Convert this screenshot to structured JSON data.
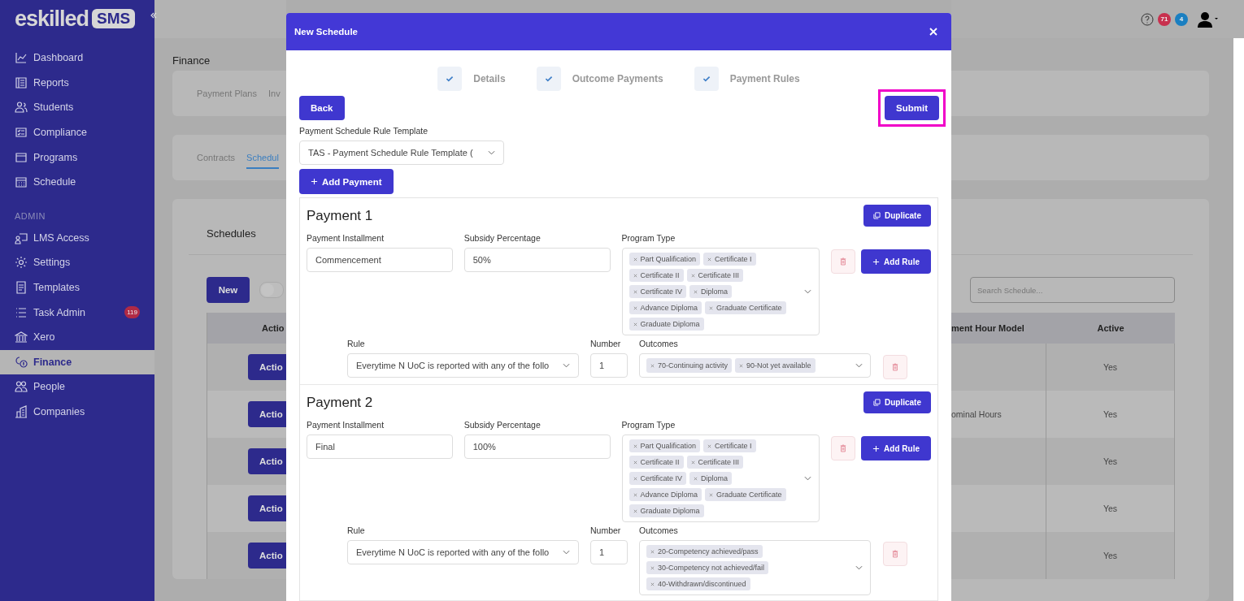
{
  "sidebar": {
    "logo": "eskilled",
    "logo_badge": "SMS",
    "groups": [
      {
        "items": [
          {
            "label": "Dashboard",
            "selected": false
          },
          {
            "label": "Reports",
            "selected": false
          },
          {
            "label": "Students",
            "selected": false
          },
          {
            "label": "Compliance",
            "selected": false
          },
          {
            "label": "Programs",
            "selected": false
          },
          {
            "label": "Schedule",
            "selected": false
          }
        ]
      },
      {
        "heading": "ADMIN",
        "items": [
          {
            "label": "LMS Access",
            "selected": false
          },
          {
            "label": "Settings",
            "selected": false
          },
          {
            "label": "Templates",
            "selected": false
          },
          {
            "label": "Task Admin",
            "selected": false,
            "badge": "119"
          },
          {
            "label": "Xero",
            "selected": false
          },
          {
            "label": "Finance",
            "selected": true
          },
          {
            "label": "People",
            "selected": false
          },
          {
            "label": "Companies",
            "selected": false
          }
        ]
      }
    ]
  },
  "topbar": {
    "badges": [
      {
        "count": "71",
        "color": "#c8304e"
      },
      {
        "count": "4",
        "color": "#1a7fc1"
      }
    ]
  },
  "page": {
    "title": "Finance",
    "tabs_top": [
      {
        "label": "Payment Plans",
        "selected": false
      },
      {
        "label": "Inv",
        "selected": false
      }
    ],
    "tabs_sub": [
      {
        "label": "Contracts",
        "selected": false
      },
      {
        "label": "Schedul",
        "selected": true
      }
    ],
    "schedules": {
      "title": "Schedules",
      "new_button": "New",
      "toggle": {
        "on": false
      },
      "search": {
        "placeholder": "Search Schedule..."
      },
      "columns": [
        "Actio",
        "ment Hour Model",
        "Active"
      ],
      "rows": [
        {
          "action": "Actio",
          "active": "Yes"
        },
        {
          "action": "Actio",
          "hour_model": "ominal Hours",
          "active": "Yes"
        },
        {
          "action": "Actio",
          "active": "Yes"
        },
        {
          "action": "Actio",
          "active": "Yes"
        },
        {
          "action": "Actio",
          "active": "Yes"
        }
      ]
    }
  },
  "modal": {
    "title": "New Schedule",
    "steps": [
      {
        "label": "Details",
        "done": true
      },
      {
        "label": "Outcome Payments",
        "done": true
      },
      {
        "label": "Payment Rules",
        "done": true
      }
    ],
    "back": "Back",
    "submit": {
      "label": "Submit",
      "highlighted": true
    },
    "template_label": "Payment Schedule Rule Template",
    "template_value": "TAS - Payment Schedule Rule Template (",
    "add_payment": "Add Payment",
    "payments": [
      {
        "title": "Payment 1",
        "duplicate": "Duplicate",
        "installment_label": "Payment Installment",
        "installment": "Commencement",
        "subsidy_label": "Subsidy Percentage",
        "subsidy": "50%",
        "program_label": "Program Type",
        "program_types": [
          "Part Qualification",
          "Certificate I",
          "Certificate II",
          "Certificate III",
          "Certificate IV",
          "Diploma",
          "Advance Diploma",
          "Graduate Certificate",
          "Graduate Diploma"
        ],
        "add_rule": "Add Rule",
        "rules": [
          {
            "rule_label": "Rule",
            "rule": "Everytime N UoC is reported with any of the follo",
            "number_label": "Number",
            "number": "1",
            "outcomes_label": "Outcomes",
            "outcomes": [
              "70-Continuing activity",
              "90-Not yet available"
            ]
          }
        ]
      },
      {
        "title": "Payment 2",
        "duplicate": "Duplicate",
        "installment_label": "Payment Installment",
        "installment": "Final",
        "subsidy_label": "Subsidy Percentage",
        "subsidy": "100%",
        "program_label": "Program Type",
        "program_types": [
          "Part Qualification",
          "Certificate I",
          "Certificate II",
          "Certificate III",
          "Certificate IV",
          "Diploma",
          "Advance Diploma",
          "Graduate Certificate",
          "Graduate Diploma"
        ],
        "add_rule": "Add Rule",
        "rules": [
          {
            "rule_label": "Rule",
            "rule": "Everytime N UoC is reported with any of the follo",
            "number_label": "Number",
            "number": "1",
            "outcomes_label": "Outcomes",
            "outcomes": [
              "20-Competency achieved/pass",
              "30-Competency not achieved/fail",
              "40-Withdrawn/discontinued"
            ]
          }
        ]
      }
    ]
  }
}
